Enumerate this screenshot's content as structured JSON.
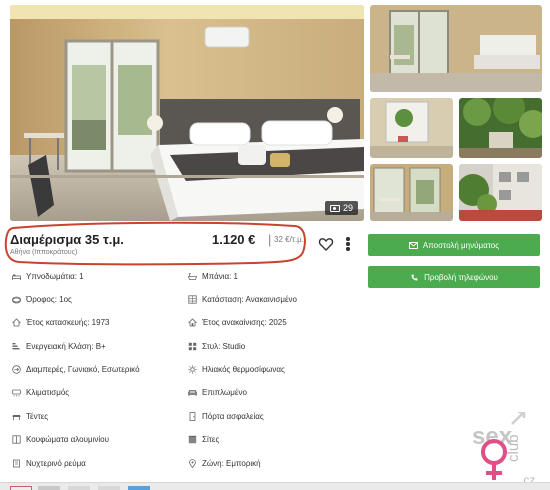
{
  "gallery": {
    "photo_count": "29"
  },
  "listing": {
    "title": "Διαμέρισμα 35 τ.μ.",
    "location": "Αθήνα (Ιπποκράτους)",
    "price": "1.120 €",
    "price_separator": "|",
    "price_per_sqm": "32 €/τ.μ."
  },
  "actions": {
    "message_label": "Αποστολή μηνύματος",
    "phone_label": "Προβολή τηλεφώνου"
  },
  "features": {
    "left": [
      {
        "icon": "bed-icon",
        "label": "Υπνοδωμάτια: 1"
      },
      {
        "icon": "stairs-icon",
        "label": "Όροφος: 1ος"
      },
      {
        "icon": "house-icon",
        "label": "Έτος κατασκευής: 1973"
      },
      {
        "icon": "energy-icon",
        "label": "Ενεργειακή Κλάση: Β+"
      },
      {
        "icon": "layout-icon",
        "label": "Διαμπερές, Γωνιακό, Εσωτερικό"
      },
      {
        "icon": "snowflake-icon",
        "label": "Κλιματισμός"
      },
      {
        "icon": "awning-icon",
        "label": "Τέντες"
      },
      {
        "icon": "window-icon",
        "label": "Κουφώματα αλουμινίου"
      },
      {
        "icon": "power-icon",
        "label": "Νυχτερινό ρεύμα"
      }
    ],
    "right": [
      {
        "icon": "bath-icon",
        "label": "Μπάνια: 1"
      },
      {
        "icon": "condition-icon",
        "label": "Κατάσταση: Ανακαινισμένο"
      },
      {
        "icon": "renovation-icon",
        "label": "Έτος ανακαίνισης: 2025"
      },
      {
        "icon": "style-icon",
        "label": "Στυλ: Studio"
      },
      {
        "icon": "sun-icon",
        "label": "Ηλιακός θερμοσίφωνας"
      },
      {
        "icon": "sofa-icon",
        "label": "Επιπλωμένο"
      },
      {
        "icon": "door-icon",
        "label": "Πόρτα ασφαλείας"
      },
      {
        "icon": "screen-icon",
        "label": "Σίτες"
      },
      {
        "icon": "zone-icon",
        "label": "Ζώνη: Εμπορική"
      }
    ]
  },
  "watermark": {
    "text_top": "sex",
    "text_bottom": "club",
    "suffix": ".cz"
  },
  "colors": {
    "accent_green": "#4caa4f",
    "highlight_red": "#c8442e",
    "watermark_pink": "#e04f86"
  }
}
